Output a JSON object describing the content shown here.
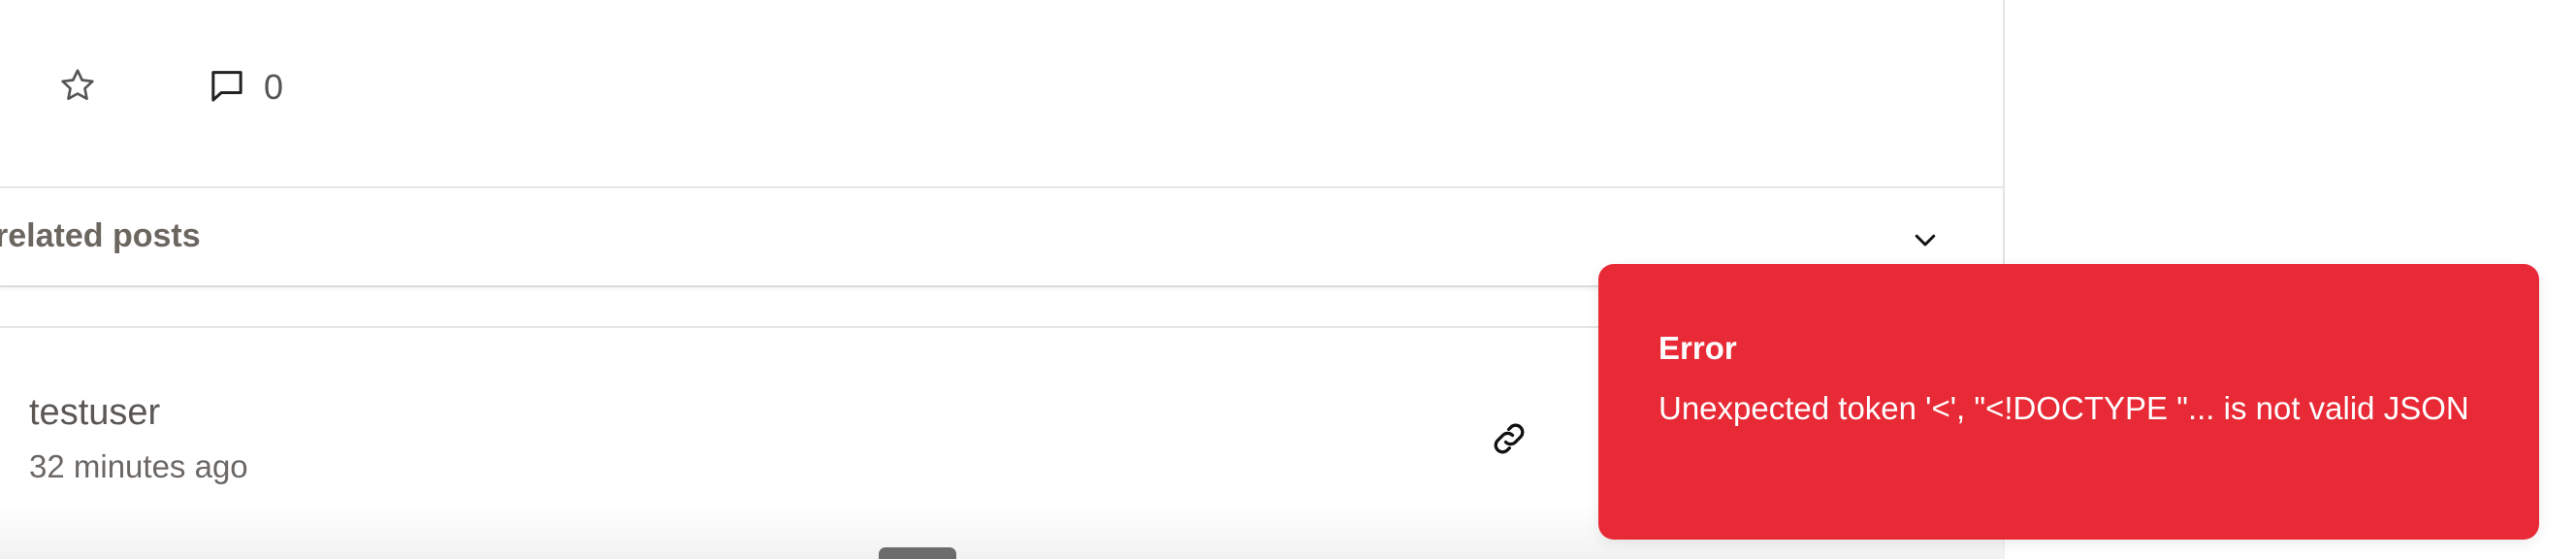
{
  "post_actions": {
    "star_icon": "star-icon",
    "comment_icon": "speech-bubble-icon",
    "comment_count": "0"
  },
  "related_posts": {
    "label": "related posts",
    "chevron_icon": "chevron-down-icon"
  },
  "comment": {
    "username": "testuser",
    "timestamp": "32 minutes ago",
    "link_icon": "link-icon"
  },
  "toast": {
    "title": "Error",
    "message": "Unexpected token '<', \"<!DOCTYPE \"... is not valid JSON",
    "background_color": "#e82a36"
  },
  "colors": {
    "text_muted": "#6b6660",
    "divider": "#e4e4e4"
  }
}
